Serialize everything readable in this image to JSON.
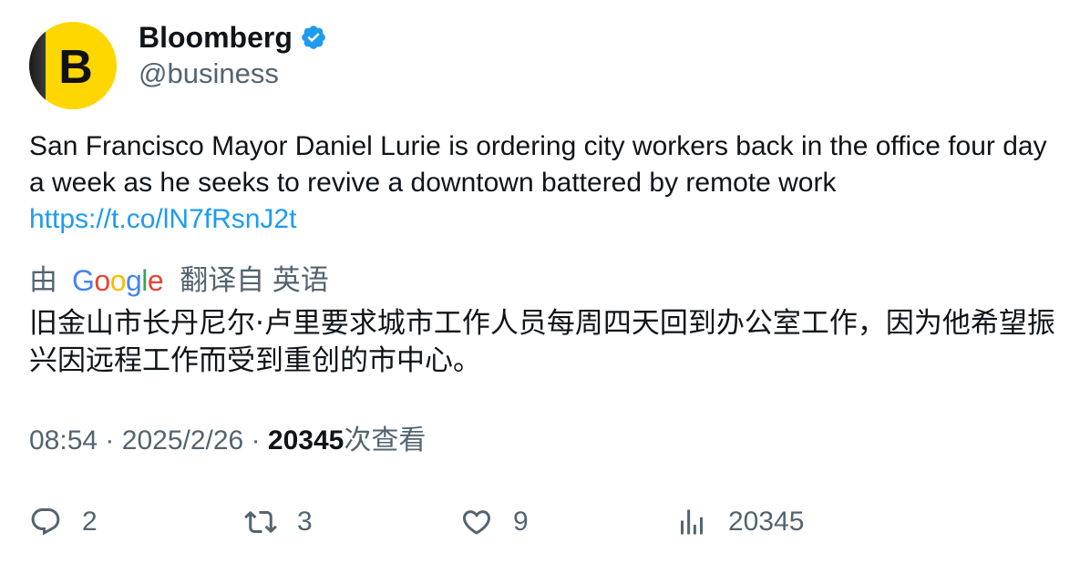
{
  "author": {
    "name": "Bloomberg",
    "handle": "@business",
    "avatar_letter": "B",
    "verified_icon": "verified-badge-icon",
    "brand_color": "#ffd700",
    "verified_color": "#1d9bf0"
  },
  "tweet": {
    "text": "San Francisco Mayor Daniel Lurie is ordering city workers back in the office four day a week as he seeks to revive a downtown battered by remote work",
    "link": "https://t.co/lN7fRsnJ2t"
  },
  "translation": {
    "by_label": "由",
    "provider_letters": [
      "G",
      "o",
      "o",
      "g",
      "l",
      "e"
    ],
    "translated_from_label": "翻译自 英语",
    "text": "旧金山市长丹尼尔·卢里要求城市工作人员每周四天回到办公室工作，因为他希望振兴因远程工作而受到重创的市中心。"
  },
  "meta": {
    "time": "08:54",
    "separator": "·",
    "date": "2025/2/26",
    "views_count": "20345",
    "views_label": "次查看"
  },
  "actions": {
    "replies": "2",
    "retweets": "3",
    "likes": "9",
    "views": "20345"
  },
  "colors": {
    "text_primary": "#0f1419",
    "text_secondary": "#536471",
    "link": "#1d9bf0"
  }
}
